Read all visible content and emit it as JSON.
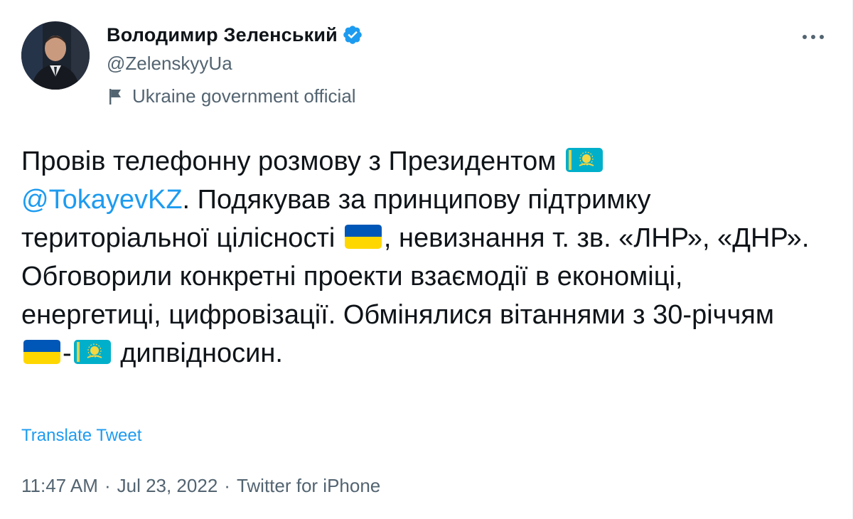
{
  "author": {
    "display_name": "Володимир Зеленський",
    "handle": "@ZelenskyyUa",
    "verified_icon": "verified-badge-icon",
    "label": "Ukraine government official",
    "label_icon": "flag-icon"
  },
  "tweet": {
    "segment_1": "Провів телефонну розмову з Президентом",
    "mention": "@TokayevKZ",
    "segment_2": ". Подякував за принципову підтримку територіальної цілісності",
    "segment_3": ", невизнання т. зв. «ЛНР», «ДНР». Обговорили конкретні проекти взаємодії в економіці, енергетиці, цифровізації. Обмінялися вітаннями з 30-річчям",
    "segment_4": "-",
    "segment_5": "дипвідносин.",
    "emojis": [
      "flag-kazakhstan",
      "flag-ukraine",
      "flag-ukraine",
      "flag-kazakhstan"
    ]
  },
  "translate_label": "Translate Tweet",
  "meta": {
    "time": "11:47 AM",
    "separator": "·",
    "date": "Jul 23, 2022",
    "source": "Twitter for iPhone"
  },
  "colors": {
    "text": "#0f1419",
    "secondary": "#536471",
    "accent": "#1d9bf0",
    "ukraine_blue": "#0057b7",
    "ukraine_yellow": "#ffd700",
    "kazakhstan_blue": "#00afca"
  }
}
